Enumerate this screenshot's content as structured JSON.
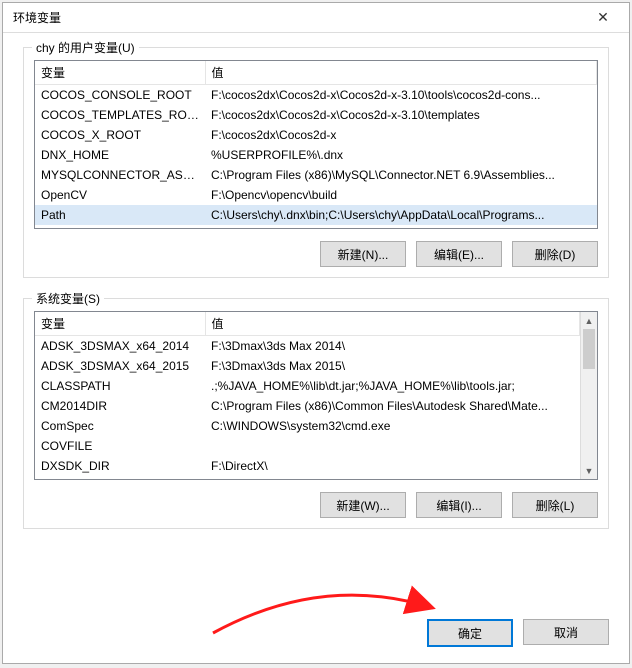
{
  "titlebar": {
    "title": "环境变量"
  },
  "user_group": {
    "label": "chy 的用户变量(U)",
    "columns": {
      "var": "变量",
      "val": "值"
    },
    "rows": [
      {
        "var": "COCOS_CONSOLE_ROOT",
        "val": "F:\\cocos2dx\\Cocos2d-x\\Cocos2d-x-3.10\\tools\\cocos2d-cons...",
        "selected": false
      },
      {
        "var": "COCOS_TEMPLATES_ROOT",
        "val": "F:\\cocos2dx\\Cocos2d-x\\Cocos2d-x-3.10\\templates",
        "selected": false
      },
      {
        "var": "COCOS_X_ROOT",
        "val": "F:\\cocos2dx\\Cocos2d-x",
        "selected": false
      },
      {
        "var": "DNX_HOME",
        "val": "%USERPROFILE%\\.dnx",
        "selected": false
      },
      {
        "var": "MYSQLCONNECTOR_ASS...",
        "val": "C:\\Program Files (x86)\\MySQL\\Connector.NET 6.9\\Assemblies...",
        "selected": false
      },
      {
        "var": "OpenCV",
        "val": "F:\\Opencv\\opencv\\build",
        "selected": false
      },
      {
        "var": "Path",
        "val": "C:\\Users\\chy\\.dnx\\bin;C:\\Users\\chy\\AppData\\Local\\Programs...",
        "selected": true
      }
    ],
    "buttons": {
      "new": "新建(N)...",
      "edit": "编辑(E)...",
      "delete": "删除(D)"
    }
  },
  "system_group": {
    "label": "系统变量(S)",
    "columns": {
      "var": "变量",
      "val": "值"
    },
    "rows": [
      {
        "var": "ADSK_3DSMAX_x64_2014",
        "val": "F:\\3Dmax\\3ds Max 2014\\"
      },
      {
        "var": "ADSK_3DSMAX_x64_2015",
        "val": "F:\\3Dmax\\3ds Max 2015\\"
      },
      {
        "var": "CLASSPATH",
        "val": ".;%JAVA_HOME%\\lib\\dt.jar;%JAVA_HOME%\\lib\\tools.jar;"
      },
      {
        "var": "CM2014DIR",
        "val": "C:\\Program Files (x86)\\Common Files\\Autodesk Shared\\Mate..."
      },
      {
        "var": "ComSpec",
        "val": "C:\\WINDOWS\\system32\\cmd.exe"
      },
      {
        "var": "COVFILE",
        "val": ""
      },
      {
        "var": "DXSDK_DIR",
        "val": "F:\\DirectX\\"
      }
    ],
    "buttons": {
      "new": "新建(W)...",
      "edit": "编辑(I)...",
      "delete": "删除(L)"
    }
  },
  "footer": {
    "ok": "确定",
    "cancel": "取消"
  }
}
